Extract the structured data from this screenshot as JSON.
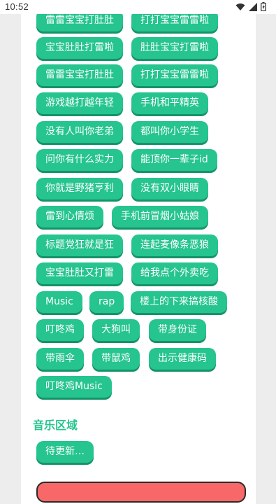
{
  "status": {
    "time": "10:52"
  },
  "rows": [
    [
      "雷雷宝宝打肚肚",
      "打打宝宝雷雷啦"
    ],
    [
      "宝宝肚肚打雷啦",
      "肚肚宝宝打雷啦"
    ],
    [
      "雷雷宝宝打肚肚",
      "打打宝宝雷雷啦"
    ],
    [
      "游戏越打越年轻",
      "手机和平精英"
    ],
    [
      "没有人叫你老弟",
      "都叫你小学生"
    ],
    [
      "问你有什么实力",
      "能顶你一辈子id"
    ],
    [
      "你就是野猪亨利",
      "没有双小眼睛"
    ],
    [
      "雷到心情烦",
      "手机前冒烟小姑娘"
    ],
    [
      "标题党狂就是狂",
      "连起麦像条恶狼"
    ],
    [
      "宝宝肚肚又打雷",
      "给我点个外卖吃"
    ],
    [
      "Music",
      "rap",
      "楼上的下来搞核酸"
    ],
    [
      "叮咚鸡",
      "大狗叫",
      "带身份证"
    ],
    [
      "带雨伞",
      "带鼠鸡",
      "出示健康码"
    ],
    [
      "叮咚鸡Music"
    ]
  ],
  "music_section": {
    "title": "音乐区域",
    "items": [
      "待更新…"
    ]
  },
  "colors": {
    "chip": "#26c48f",
    "chip_shadow": "#14936a",
    "accent": "#26c48f",
    "bottom_button": "#f86868"
  }
}
